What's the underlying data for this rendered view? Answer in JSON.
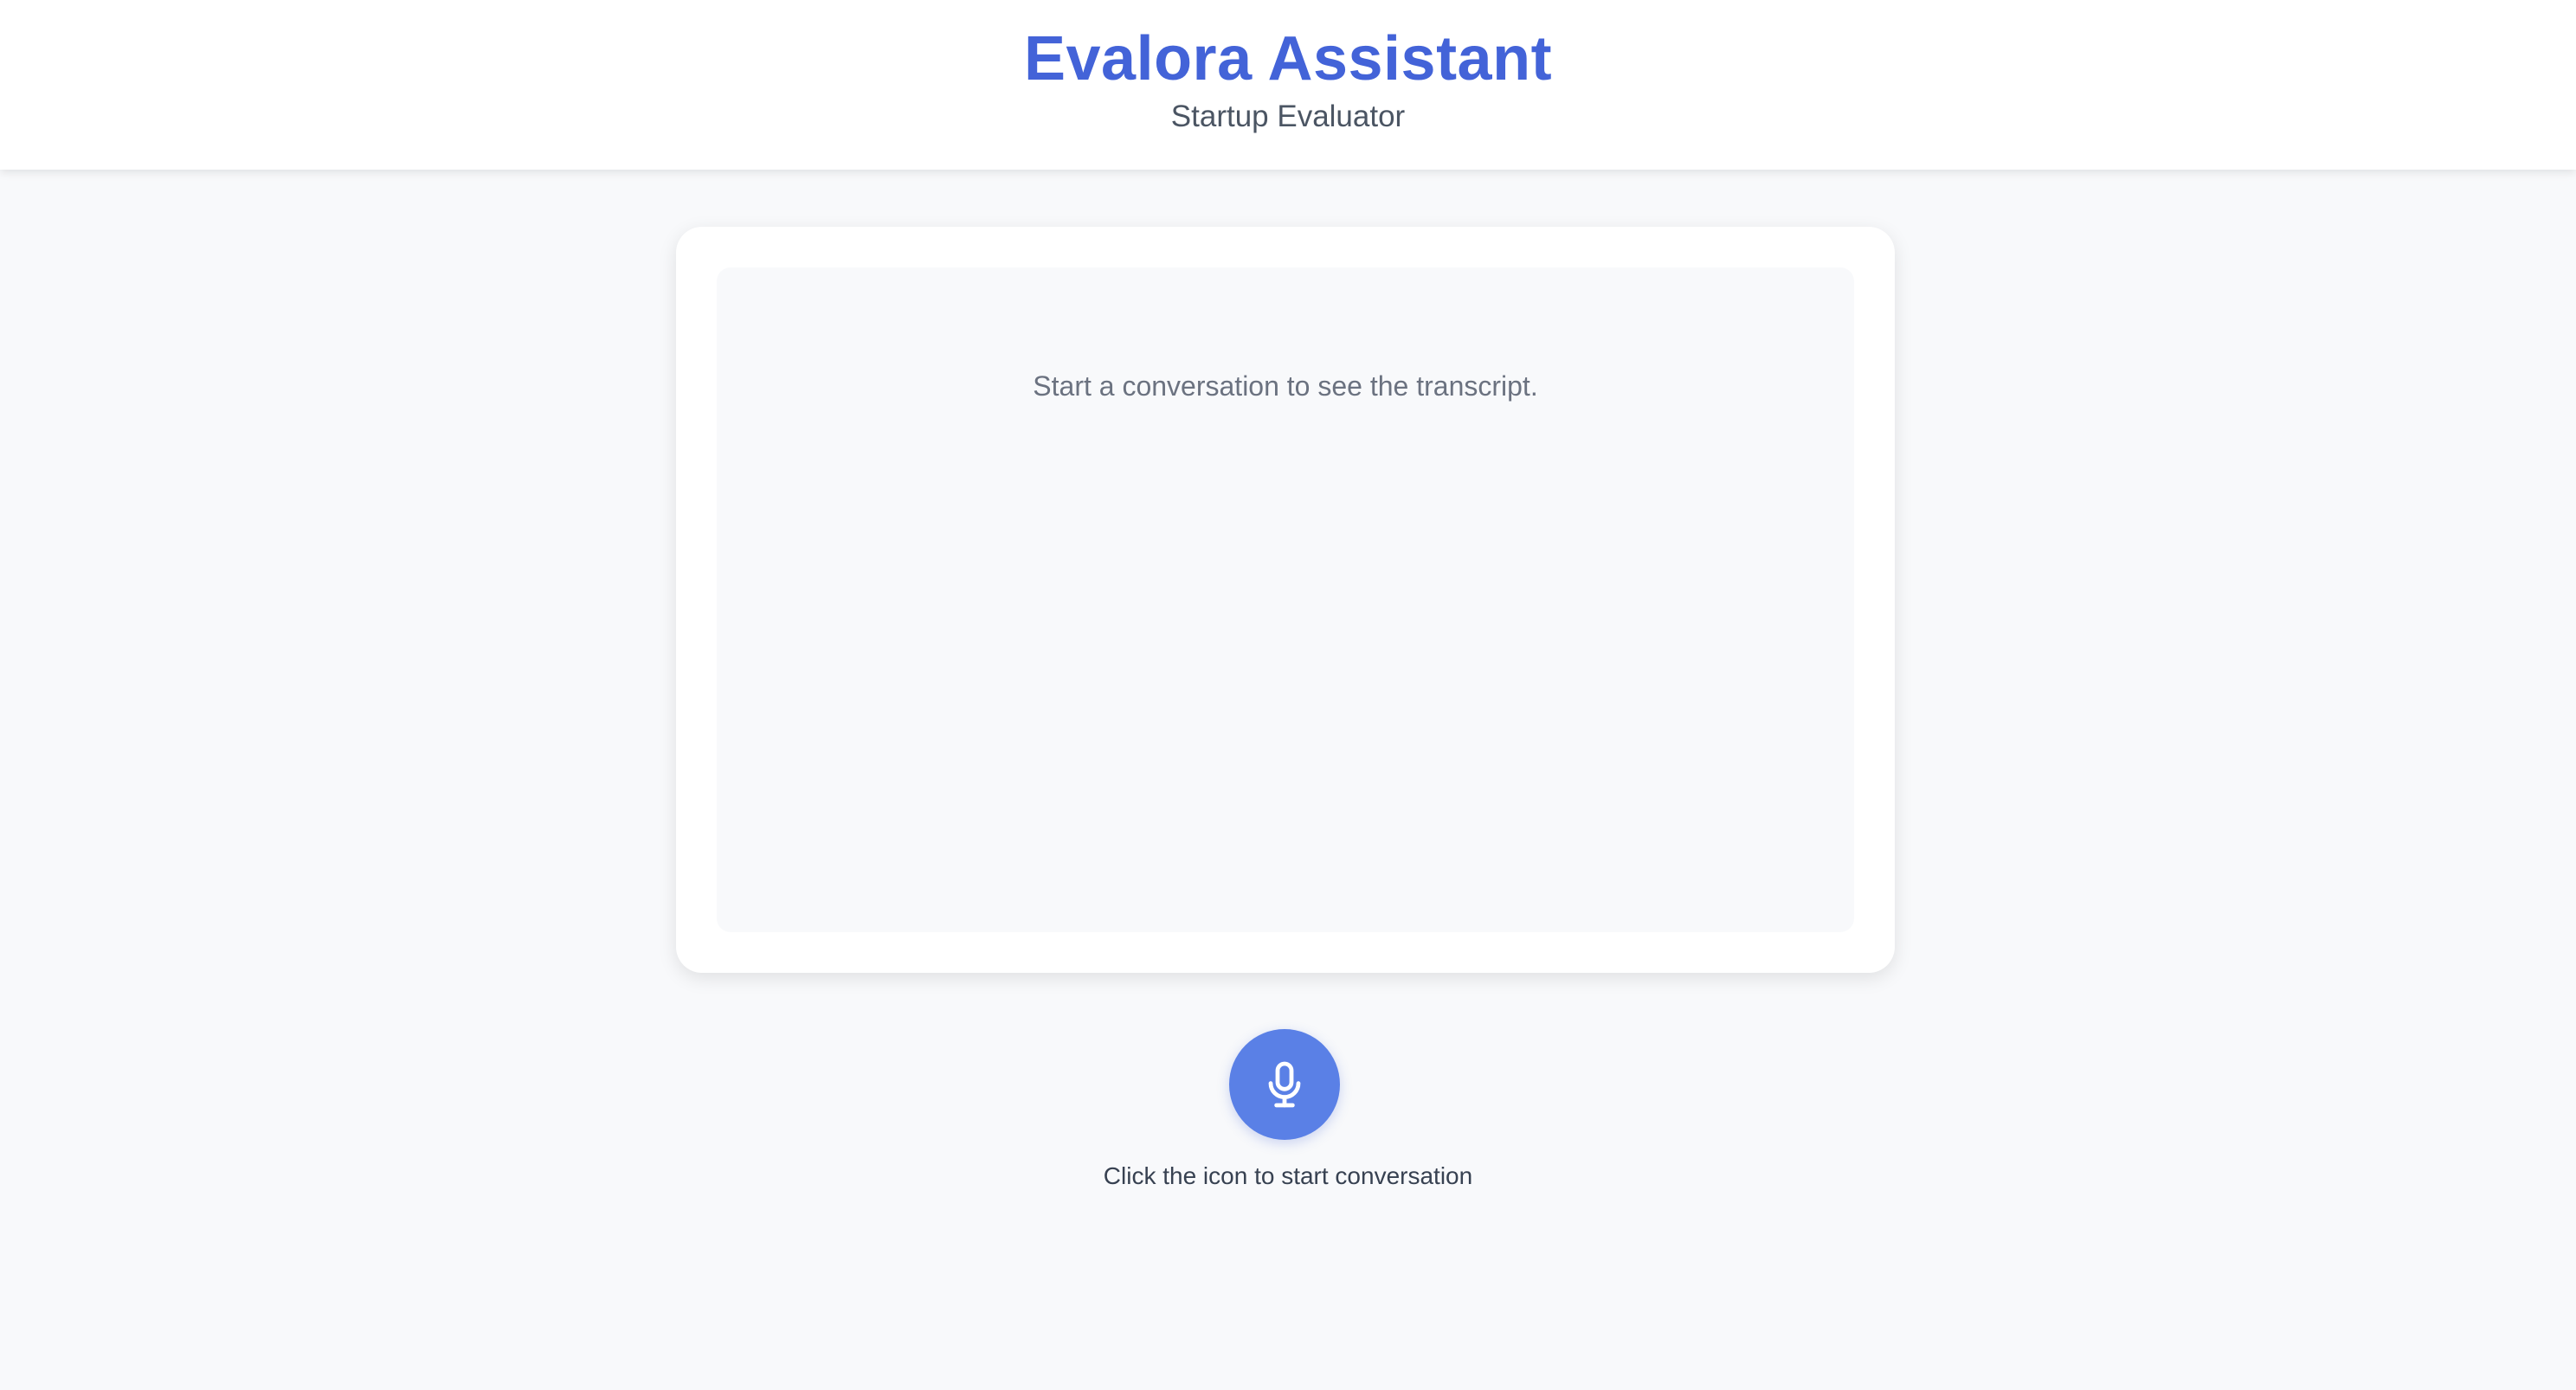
{
  "header": {
    "title": "Evalora Assistant",
    "subtitle": "Startup Evaluator"
  },
  "transcript": {
    "placeholder": "Start a conversation to see the transcript."
  },
  "controls": {
    "mic_icon": "microphone-icon",
    "hint": "Click the icon to start conversation"
  },
  "colors": {
    "accent": "#4363d8",
    "mic_button": "#5a80e6",
    "background": "#f8f9fb"
  }
}
